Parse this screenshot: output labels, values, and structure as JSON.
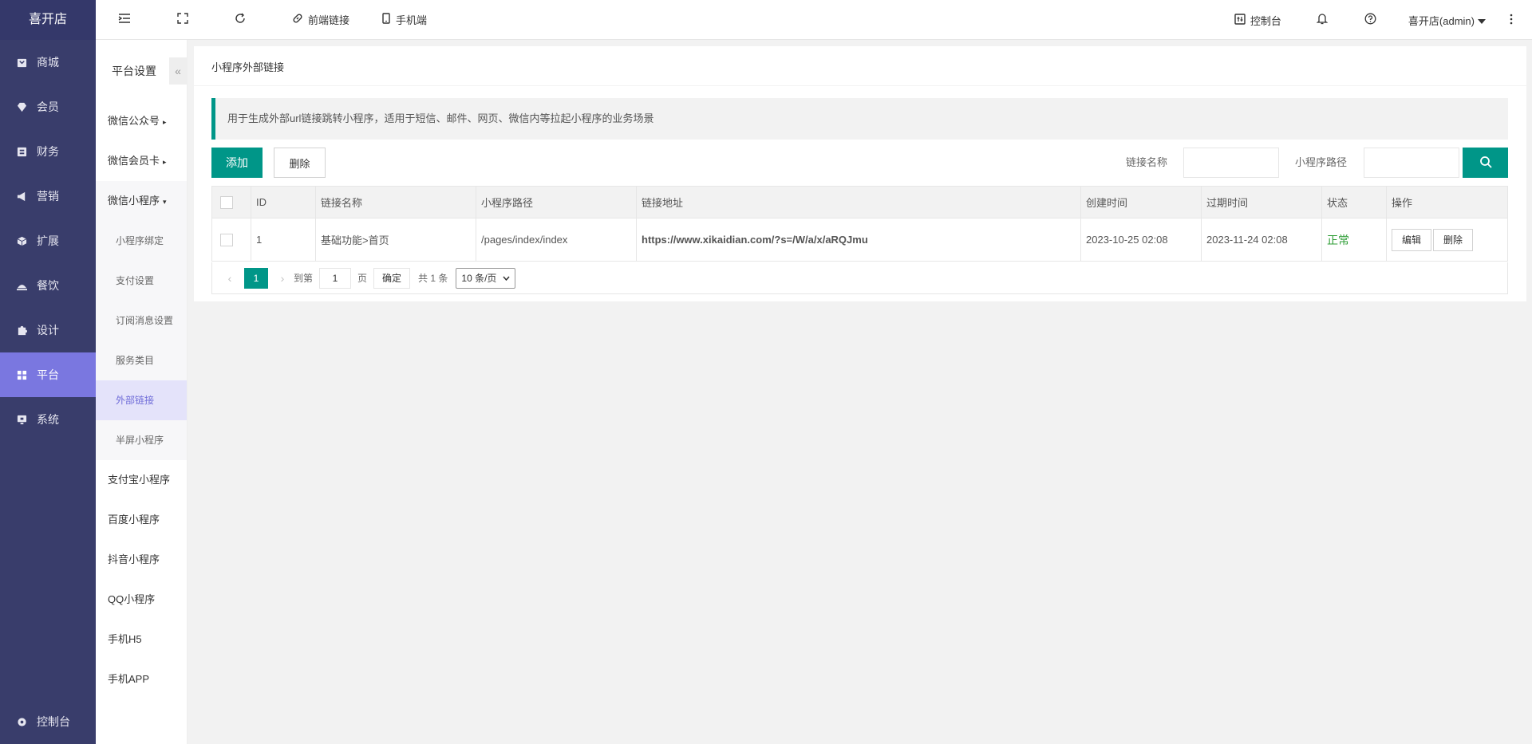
{
  "brand": {
    "name": "喜开店"
  },
  "sidebar": {
    "items": [
      {
        "label": "商城",
        "icon": "shop-icon"
      },
      {
        "label": "会员",
        "icon": "gem-icon"
      },
      {
        "label": "财务",
        "icon": "finance-icon"
      },
      {
        "label": "营销",
        "icon": "megaphone-icon"
      },
      {
        "label": "扩展",
        "icon": "cube-icon"
      },
      {
        "label": "餐饮",
        "icon": "dish-icon"
      },
      {
        "label": "设计",
        "icon": "puzzle-icon"
      },
      {
        "label": "平台",
        "icon": "grid-icon",
        "active": true
      },
      {
        "label": "系统",
        "icon": "monitor-icon"
      }
    ],
    "bottom": {
      "label": "控制台",
      "icon": "gear-icon"
    }
  },
  "submenu": {
    "title": "平台设置",
    "collapse_icon": "«",
    "items": [
      {
        "label": "微信公众号",
        "caret": "▸"
      },
      {
        "label": "微信会员卡",
        "caret": "▸"
      },
      {
        "label": "微信小程序",
        "caret": "▾"
      }
    ],
    "children": [
      {
        "label": "小程序绑定"
      },
      {
        "label": "支付设置"
      },
      {
        "label": "订阅消息设置"
      },
      {
        "label": "服务类目"
      },
      {
        "label": "外部链接",
        "active": true
      },
      {
        "label": "半屏小程序"
      }
    ],
    "more": [
      {
        "label": "支付宝小程序"
      },
      {
        "label": "百度小程序"
      },
      {
        "label": "抖音小程序"
      },
      {
        "label": "QQ小程序"
      },
      {
        "label": "手机H5"
      },
      {
        "label": "手机APP"
      }
    ]
  },
  "topbar": {
    "frontend_link": "前端链接",
    "mobile": "手机端",
    "console": "控制台",
    "user": "喜开店(admin)"
  },
  "page": {
    "title": "小程序外部链接",
    "tip": "用于生成外部url链接跳转小程序，适用于短信、邮件、网页、微信内等拉起小程序的业务场景"
  },
  "toolbar": {
    "add": "添加",
    "delete": "删除",
    "filter_name_label": "链接名称",
    "filter_path_label": "小程序路径"
  },
  "table": {
    "headers": [
      "ID",
      "链接名称",
      "小程序路径",
      "链接地址",
      "创建时间",
      "过期时间",
      "状态",
      "操作"
    ],
    "rows": [
      {
        "id": "1",
        "name": "基础功能>首页",
        "path": "/pages/index/index",
        "url": "https://www.xikaidian.com/?s=/W/a/x/aRQJmu",
        "created": "2023-10-25 02:08",
        "expires": "2023-11-24 02:08",
        "status": "正常",
        "edit": "编辑",
        "del": "删除"
      }
    ]
  },
  "pager": {
    "current": "1",
    "goto_label": "到第",
    "page_input": "1",
    "page_unit": "页",
    "confirm": "确定",
    "total": "共 1 条",
    "per_page": "10 条/页"
  },
  "colors": {
    "primary": "#009688",
    "sidebar": "#393d6b",
    "active": "#7a77e0",
    "status_ok": "#2d9d35"
  }
}
